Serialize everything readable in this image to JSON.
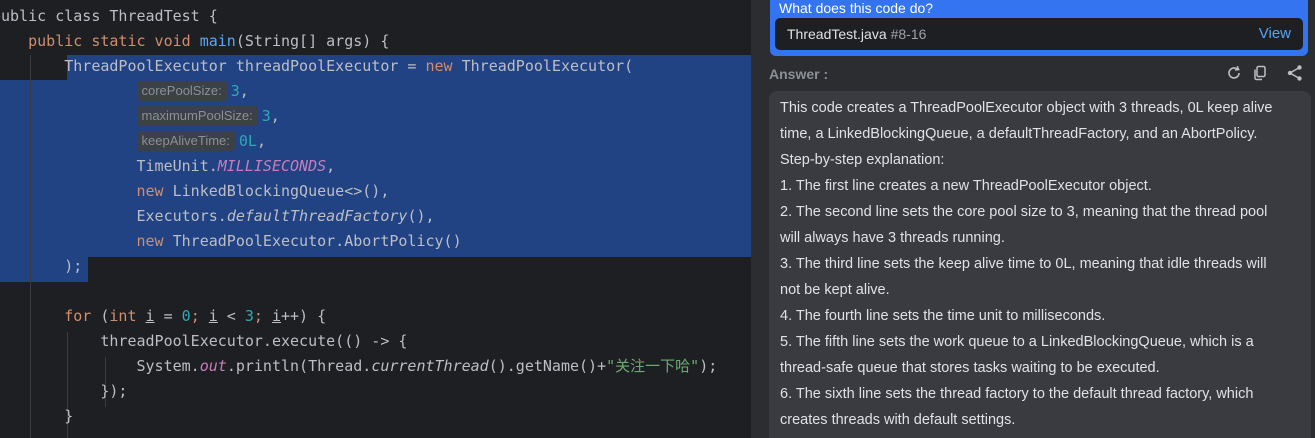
{
  "editor": {
    "lines": [
      {
        "tokens": [
          {
            "t": "public class ThreadTest {",
            "c": "plain"
          }
        ]
      },
      {
        "tokens": [
          {
            "t": "    public static void ",
            "c": "kw"
          },
          {
            "t": "main",
            "c": "fn"
          },
          {
            "t": "(String[] args) {",
            "c": "plain"
          }
        ]
      },
      {
        "tokens": [
          {
            "t": "        ThreadPoolExecutor threadPoolExecutor = ",
            "c": "plain"
          },
          {
            "t": "new ",
            "c": "kw"
          },
          {
            "t": "ThreadPoolExecutor(",
            "c": "plain"
          }
        ]
      },
      {
        "tokens": [
          {
            "t": "                ",
            "c": "plain"
          },
          {
            "t": "corePoolSize:",
            "c": "hint"
          },
          {
            "t": "3",
            "c": "num"
          },
          {
            "t": ",",
            "c": "plain"
          }
        ]
      },
      {
        "tokens": [
          {
            "t": "                ",
            "c": "plain"
          },
          {
            "t": "maximumPoolSize:",
            "c": "hint"
          },
          {
            "t": "3",
            "c": "num"
          },
          {
            "t": ",",
            "c": "plain"
          }
        ]
      },
      {
        "tokens": [
          {
            "t": "                ",
            "c": "plain"
          },
          {
            "t": "keepAliveTime:",
            "c": "hint"
          },
          {
            "t": "0L",
            "c": "num"
          },
          {
            "t": ",",
            "c": "plain"
          }
        ]
      },
      {
        "tokens": [
          {
            "t": "                TimeUnit.",
            "c": "plain"
          },
          {
            "t": "MILLISECONDS",
            "c": "const"
          },
          {
            "t": ",",
            "c": "plain"
          }
        ]
      },
      {
        "tokens": [
          {
            "t": "                ",
            "c": "plain"
          },
          {
            "t": "new ",
            "c": "kw"
          },
          {
            "t": "LinkedBlockingQueue<>(),",
            "c": "plain"
          }
        ]
      },
      {
        "tokens": [
          {
            "t": "                Executors.",
            "c": "plain"
          },
          {
            "t": "defaultThreadFactory",
            "c": "it"
          },
          {
            "t": "(),",
            "c": "plain"
          }
        ]
      },
      {
        "tokens": [
          {
            "t": "                ",
            "c": "plain"
          },
          {
            "t": "new ",
            "c": "kw"
          },
          {
            "t": "ThreadPoolExecutor.AbortPolicy()",
            "c": "plain"
          }
        ]
      },
      {
        "tokens": [
          {
            "t": "        );",
            "c": "plain"
          }
        ]
      },
      {
        "tokens": [
          {
            "t": "",
            "c": "plain"
          }
        ]
      },
      {
        "tokens": [
          {
            "t": "        ",
            "c": "plain"
          },
          {
            "t": "for ",
            "c": "kw"
          },
          {
            "t": "(",
            "c": "plain"
          },
          {
            "t": "int ",
            "c": "kw"
          },
          {
            "t": "i",
            "c": "u"
          },
          {
            "t": " = ",
            "c": "plain"
          },
          {
            "t": "0",
            "c": "num"
          },
          {
            "t": "; ",
            "c": "kw"
          },
          {
            "t": "i",
            "c": "u"
          },
          {
            "t": " < ",
            "c": "plain"
          },
          {
            "t": "3",
            "c": "num"
          },
          {
            "t": "; ",
            "c": "kw"
          },
          {
            "t": "i",
            "c": "u"
          },
          {
            "t": "++) {",
            "c": "plain"
          }
        ]
      },
      {
        "tokens": [
          {
            "t": "            threadPoolExecutor.execute(() -> {",
            "c": "plain"
          }
        ]
      },
      {
        "tokens": [
          {
            "t": "                System.",
            "c": "plain"
          },
          {
            "t": "out",
            "c": "const"
          },
          {
            "t": ".println(Thread.",
            "c": "plain"
          },
          {
            "t": "currentThread",
            "c": "it"
          },
          {
            "t": "().getName()+",
            "c": "plain"
          },
          {
            "t": "\"关注一下哈\"",
            "c": "str"
          },
          {
            "t": ");",
            "c": "plain"
          }
        ]
      },
      {
        "tokens": [
          {
            "t": "            });",
            "c": "plain"
          }
        ]
      },
      {
        "tokens": [
          {
            "t": "        }",
            "c": "plain"
          }
        ]
      }
    ]
  },
  "panel": {
    "question": "What does this code do?",
    "file_name": "ThreadTest.java",
    "file_range": "#8-16",
    "view_label": "View",
    "answer_label": "Answer :",
    "answer_lines": [
      "This code creates a ThreadPoolExecutor object with 3 threads, 0L keep alive",
      "time, a LinkedBlockingQueue, a defaultThreadFactory, and an AbortPolicy.",
      " Step-by-step explanation:",
      "1. The first line creates a new ThreadPoolExecutor object.",
      "2. The second line sets the core pool size to 3, meaning that the thread pool",
      "will always have 3 threads running.",
      "3. The third line sets the keep alive time to 0L, meaning that idle threads will",
      "not be kept alive.",
      "4. The fourth line sets the time unit to milliseconds.",
      "5. The fifth line sets the work queue to a LinkedBlockingQueue, which is a",
      "thread-safe queue that stores tasks waiting to be executed.",
      "6. The sixth line sets the thread factory to the default thread factory, which",
      "creates threads with default settings."
    ]
  },
  "icons": [
    "refresh-icon",
    "copy-icon",
    "share-icon"
  ]
}
